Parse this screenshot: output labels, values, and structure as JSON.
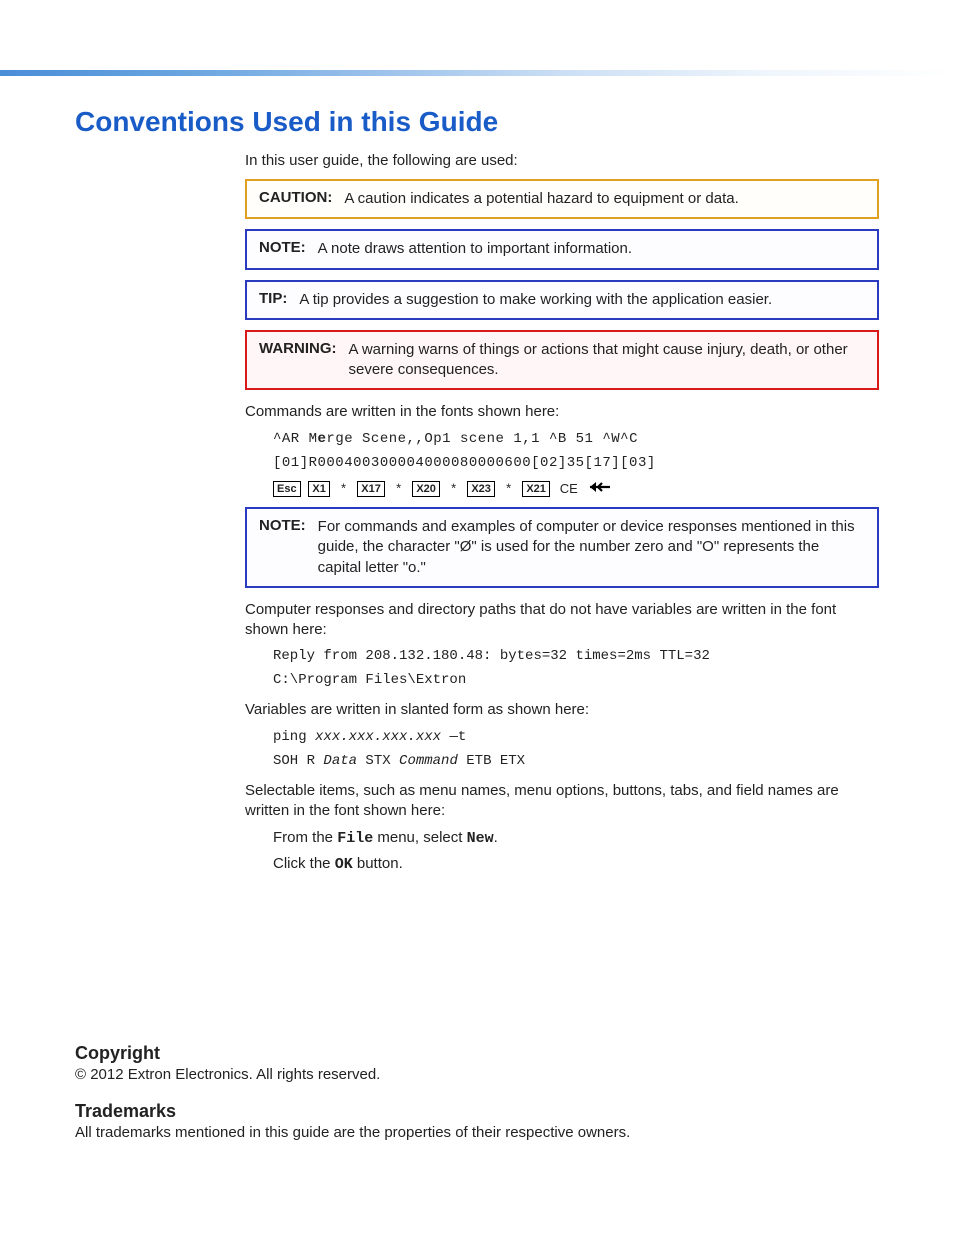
{
  "title": "Conventions Used in this Guide",
  "intro": "In this user guide, the following are used:",
  "cautionLabel": "CAUTION:",
  "cautionText": "A caution indicates a potential hazard to equipment or data.",
  "noteLabel": "NOTE:",
  "noteText": "A note draws attention to important information.",
  "tipLabel": "TIP:",
  "tipText": "A tip provides a suggestion to make working with the application easier.",
  "warningLabel": "WARNING:",
  "warningText": "A warning warns of things or actions that might cause injury, death, or other severe consequences.",
  "cmdPara": "Commands are written in the fonts shown here:",
  "cmdLine1a": "^AR M",
  "cmdLine1b": "e",
  "cmdLine1c": "rge Scene,,Op1 scene 1,1 ^B 51 ^W^C",
  "cmdLine2": "[01]R000400300004000080000600[02]35[17][03]",
  "escKey": "Esc",
  "x1Key": "X1",
  "x17Key": "X17",
  "x20Key": "X20",
  "x23Key": "X23",
  "x21Key": "X21",
  "star": "*",
  "ceText": "CE",
  "note2Label": "NOTE:",
  "note2Text": "For commands and examples of computer or device responses mentioned in this guide, the character \"Ø\" is used for the number zero and \"O\" represents the capital letter \"o.\"",
  "respPara": "Computer responses and directory paths that do not have variables are written in the font shown here:",
  "respLine1": "Reply from 208.132.180.48: bytes=32 times=2ms TTL=32",
  "respLine2": "C:\\Program Files\\Extron",
  "varPara": "Variables are written in slanted form as shown here:",
  "varLine1a": "ping ",
  "varLine1b": "xxx.xxx.xxx.xxx",
  "varLine1c": " —t",
  "varLine2a": "SOH R ",
  "varLine2b": "Data",
  "varLine2c": " STX ",
  "varLine2d": "Command",
  "varLine2e": " ETB ETX",
  "selPara": "Selectable items, such as menu names, menu options, buttons, tabs, and field names are written in the font shown here:",
  "selLine1a": "From the ",
  "selLine1b": "File",
  "selLine1c": " menu, select ",
  "selLine1d": "New",
  "selLine1e": ".",
  "selLine2a": "Click the ",
  "selLine2b": "OK",
  "selLine2c": " button.",
  "copyrightHeading": "Copyright",
  "copyrightText": "© 2012  Extron Electronics. All rights reserved.",
  "trademarksHeading": "Trademarks",
  "trademarksText": "All trademarks mentioned in this guide are the properties of their respective owners."
}
